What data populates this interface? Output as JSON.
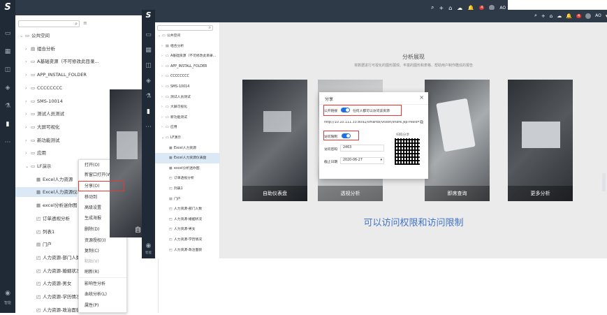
{
  "colors": {
    "topbar": "#2e3a48",
    "rail": "#1f2a36",
    "accent": "#1e6ee6",
    "highlight_red": "#e53935",
    "selected_row": "#dbe9f7",
    "annotation_blue": "#3f73c9"
  },
  "app": {
    "logo": "S",
    "user": "AO",
    "notification_count": "4",
    "rail_bottom_label": "智能"
  },
  "back": {
    "tree": [
      {
        "label": "公共空间",
        "level": 0,
        "icon": "folder-icon",
        "expanded": true
      },
      {
        "label": "组合分析",
        "level": 1,
        "icon": "file-icon"
      },
      {
        "label": "A基础资源（不可修改此目录...",
        "level": 1,
        "icon": "folder-icon"
      },
      {
        "label": "APP_INSTALL_FOLDER",
        "level": 1,
        "icon": "folder-icon"
      },
      {
        "label": "CCCCCCCC",
        "level": 1,
        "icon": "folder-icon"
      },
      {
        "label": "SMS-10014",
        "level": 1,
        "icon": "folder-icon"
      },
      {
        "label": "测试人员测试",
        "level": 1,
        "icon": "folder-icon"
      },
      {
        "label": "大屏可视化",
        "level": 1,
        "icon": "folder-icon"
      },
      {
        "label": "新功能测试",
        "level": 1,
        "icon": "folder-icon"
      },
      {
        "label": "应用",
        "level": 1,
        "icon": "folder-icon"
      },
      {
        "label": "LF演示",
        "level": 1,
        "icon": "folder-icon",
        "expanded": true
      },
      {
        "label": "Excel人力资源",
        "level": 2,
        "icon": "table-icon"
      },
      {
        "label": "Excel人力资源仪表盘",
        "level": 2,
        "icon": "table-icon",
        "selected": true
      },
      {
        "label": "excel分析迷你图",
        "level": 2,
        "icon": "table-icon"
      },
      {
        "label": "订单透视分析",
        "level": 2,
        "icon": "pivot-icon"
      },
      {
        "label": "列表1",
        "level": 2,
        "icon": "pivot-icon"
      },
      {
        "label": "门户",
        "level": 2,
        "icon": "file-icon"
      },
      {
        "label": "人力资源-部门人数",
        "level": 2,
        "icon": "pivot-icon"
      },
      {
        "label": "人力资源-婚姻状况",
        "level": 2,
        "icon": "pivot-icon"
      },
      {
        "label": "人力资源-男女",
        "level": 2,
        "icon": "pivot-icon"
      },
      {
        "label": "人力资源-学历情况",
        "level": 2,
        "icon": "pivot-icon"
      },
      {
        "label": "人力资源-政治面貌",
        "level": 2,
        "icon": "pivot-icon"
      }
    ],
    "context_menu": [
      "打开(O)",
      "新窗口打开(W)",
      "分享(O)",
      "移动到",
      "高级设置",
      "生成海报",
      "删除(D)",
      "资源授权(I)",
      "复制(C)",
      "粘贴(V)",
      "刷新(R)",
      "影响性分析",
      "血统分析(L)",
      "属性(P)"
    ],
    "card_fragment": "自"
  },
  "front": {
    "tree": [
      {
        "label": "公共空间",
        "level": 0,
        "icon": "folder-icon",
        "expanded": true
      },
      {
        "label": "组合分析",
        "level": 1,
        "icon": "file-icon"
      },
      {
        "label": "A基础资源（不可修改此目录...",
        "level": 1,
        "icon": "folder-icon"
      },
      {
        "label": "APP_INSTALL_FOLDER",
        "level": 1,
        "icon": "folder-icon"
      },
      {
        "label": "CCCCCCCC",
        "level": 1,
        "icon": "folder-icon"
      },
      {
        "label": "SMS-10014",
        "level": 1,
        "icon": "folder-icon"
      },
      {
        "label": "测试人员测试",
        "level": 1,
        "icon": "folder-icon"
      },
      {
        "label": "大屏可视化",
        "level": 1,
        "icon": "folder-icon"
      },
      {
        "label": "新功能测试",
        "level": 1,
        "icon": "folder-icon"
      },
      {
        "label": "应用",
        "level": 1,
        "icon": "folder-icon"
      },
      {
        "label": "LF演示",
        "level": 1,
        "icon": "folder-icon",
        "expanded": true
      },
      {
        "label": "Excel人力资源",
        "level": 2,
        "icon": "table-icon"
      },
      {
        "label": "Excel人力资源仪表盘",
        "level": 2,
        "icon": "table-icon",
        "selected": true
      },
      {
        "label": "excel分析迷你图",
        "level": 2,
        "icon": "table-icon"
      },
      {
        "label": "订单透视分析",
        "level": 2,
        "icon": "pivot-icon"
      },
      {
        "label": "列表1",
        "level": 2,
        "icon": "pivot-icon"
      },
      {
        "label": "门户",
        "level": 2,
        "icon": "file-icon"
      },
      {
        "label": "人力资源-部门人数",
        "level": 2,
        "icon": "pivot-icon"
      },
      {
        "label": "人力资源-婚姻状况",
        "level": 2,
        "icon": "pivot-icon"
      },
      {
        "label": "人力资源-男女",
        "level": 2,
        "icon": "pivot-icon"
      },
      {
        "label": "人力资源-学历情况",
        "level": 2,
        "icon": "pivot-icon"
      },
      {
        "label": "人力资源-政治面貌",
        "level": 2,
        "icon": "pivot-icon"
      }
    ],
    "main": {
      "title": "分析展现",
      "subtitle": "将数据进行可视化的图形展现、丰富的图形和表格、帮助用户制作酷炫的报告",
      "cards": [
        "自助仪表盘",
        "透视分析",
        "即席查询",
        "更多分析"
      ],
      "annotation": "可以访问权限和访问限制"
    },
    "share_dialog": {
      "title": "分享",
      "public_label": "公开链接",
      "public_note": "任何人都可以访问该资源",
      "url": "http://10.10.111.33:8092/smartbi/vision/share.jsp?resid=",
      "scan_label": "扫码分享",
      "restrict_label": "访问限制",
      "password_label": "访问密码",
      "password_value": "2463",
      "expiry_label": "截止日期",
      "expiry_value": "2020-06-27"
    }
  }
}
